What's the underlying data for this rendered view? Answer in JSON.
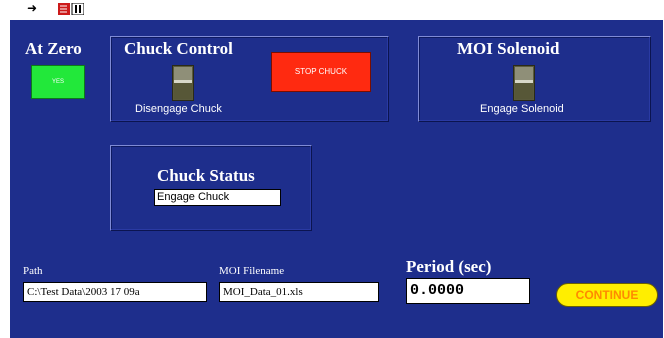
{
  "toolbar": {
    "run_arrow_icon": "right-arrow-icon",
    "run_icon": "run-continuously-icon"
  },
  "at_zero": {
    "title": "At Zero",
    "led_text": "YES",
    "led_color": "#22e83a"
  },
  "chuck_control": {
    "title": "Chuck Control",
    "switch_label": "Disengage Chuck",
    "stop_label": "STOP CHUCK",
    "stop_color": "#ff2a10"
  },
  "moi_solenoid": {
    "title": "MOI Solenoid",
    "switch_label": "Engage Solenoid"
  },
  "chuck_status": {
    "title": "Chuck Status",
    "value": "Engage Chuck"
  },
  "path": {
    "label": "Path",
    "value": "C:\\Test  Data\\2003  17  09a"
  },
  "moi_filename": {
    "label": "MOI Filename",
    "value": "MOI_Data_01.xls"
  },
  "period": {
    "label": "Period (sec)",
    "value": "0.0000"
  },
  "continue": {
    "label": "CONTINUE",
    "color": "#ffee00"
  },
  "colors": {
    "panel": "#1e2e8c"
  }
}
